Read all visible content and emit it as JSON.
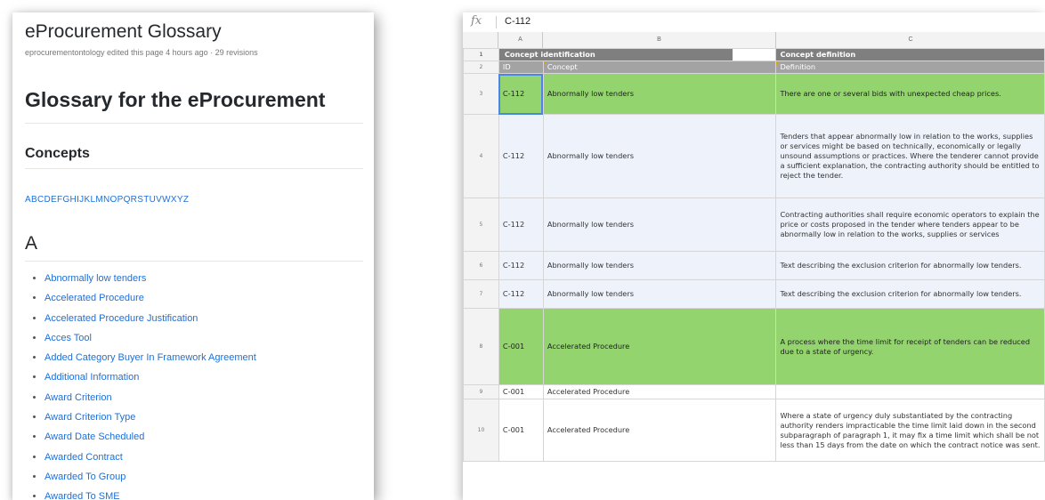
{
  "wiki": {
    "title": "eProcurement Glossary",
    "meta": "eprocurementontology edited this page 4 hours ago · 29 revisions",
    "heading": "Glossary for the eProcurement",
    "subheading": "Concepts",
    "letters": [
      "A",
      "B",
      "C",
      "D",
      "E",
      "F",
      "G",
      "H",
      "I",
      "J",
      "K",
      "L",
      "M",
      "N",
      "O",
      "P",
      "Q",
      "R",
      "S",
      "T",
      "U",
      "V",
      "W",
      "X",
      "Y",
      "Z"
    ],
    "section_letter": "A",
    "items": [
      "Abnormally low tenders",
      "Accelerated Procedure",
      "Accelerated Procedure Justification",
      "Acces Tool",
      "Added Category Buyer In Framework Agreement",
      "Additional Information",
      "Award Criterion",
      "Award Criterion Type",
      "Award Date Scheduled",
      "Awarded Contract",
      "Awarded To Group",
      "Awarded To SME"
    ]
  },
  "sheet": {
    "fx_symbol": "fx",
    "formula_value": "C-112",
    "columns": [
      "A",
      "B",
      "C"
    ],
    "header_row1": {
      "num": "1",
      "b": "Concept identification",
      "c": "Concept definition"
    },
    "header_row2": {
      "num": "2",
      "a": "ID",
      "b": "Concept",
      "c": "Definition"
    },
    "rows": [
      {
        "num": "3",
        "id": "C-112",
        "concept": "Abnormally low tenders",
        "definition": "There are one or several bids with unexpected cheap prices."
      },
      {
        "num": "4",
        "id": "C-112",
        "concept": "Abnormally low tenders",
        "definition": "Tenders that appear abnormally low in relation to the works, supplies or services might be based on technically, economically or legally unsound assumptions or practices. Where the tenderer cannot provide a sufficient explanation, the contracting authority should be entitled to reject the tender."
      },
      {
        "num": "5",
        "id": "C-112",
        "concept": "Abnormally low tenders",
        "definition": "Contracting authorities shall require economic operators to explain the price or costs proposed in the tender where tenders appear to be abnormally low in relation to the works, supplies or services"
      },
      {
        "num": "6",
        "id": "C-112",
        "concept": "Abnormally low tenders",
        "definition": "Text describing the exclusion criterion for abnormally low tenders."
      },
      {
        "num": "7",
        "id": "C-112",
        "concept": "Abnormally low tenders",
        "definition": "Text describing the exclusion criterion for abnormally low tenders."
      },
      {
        "num": "8",
        "id": "C-001",
        "concept": "Accelerated Procedure",
        "definition": "A process where the time limit for receipt of tenders can be reduced due to a state of urgency."
      },
      {
        "num": "9",
        "id": "C-001",
        "concept": "Accelerated Procedure",
        "definition": ""
      },
      {
        "num": "10",
        "id": "C-001",
        "concept": "Accelerated Procedure",
        "definition": "Where a state of urgency duly substantiated by the contracting authority renders impracticable the time limit laid down in the second subparagraph of paragraph 1, it may fix a time limit which shall be not less than 15 days from the date on which the contract notice was sent."
      }
    ]
  }
}
